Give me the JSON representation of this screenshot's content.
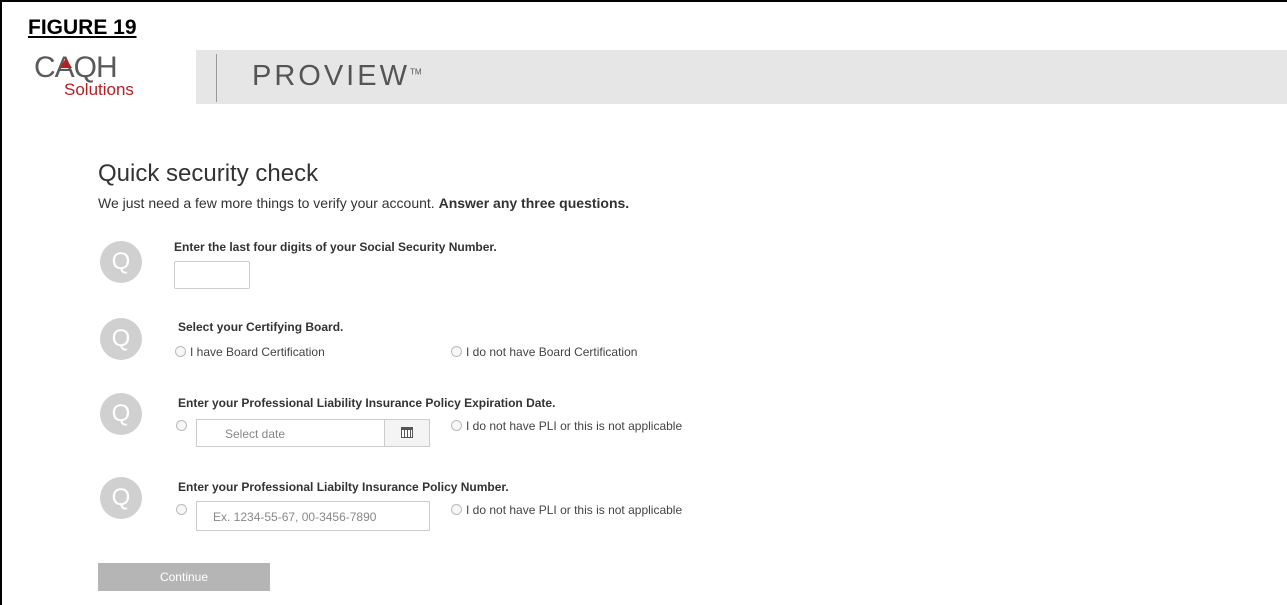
{
  "figure_label": "FIGURE 19",
  "header": {
    "logo_caqh": "CAQH",
    "logo_solutions": "Solutions",
    "product_name": "PROVIEW",
    "trademark": "TM"
  },
  "page": {
    "title": "Quick security check",
    "subtitle": "We just need a few more things to verify your account.",
    "subtitle_bold": "Answer any three questions."
  },
  "questions": [
    {
      "icon": "Q",
      "text": "Enter the last four digits of your Social Security Number.",
      "input_value": ""
    },
    {
      "icon": "Q",
      "text": "Select your Certifying Board.",
      "option_1": "I have Board Certification",
      "option_2": "I do not have Board Certification"
    },
    {
      "icon": "Q",
      "text": "Enter your Professional Liability Insurance Policy Expiration Date.",
      "placeholder": "Select date",
      "option_2": "I do not have PLI or this is not applicable"
    },
    {
      "icon": "Q",
      "text": "Enter your Professional Liabilty Insurance Policy Number.",
      "placeholder": "Ex. 1234-55-67, 00-3456-7890",
      "option_2": "I do not have PLI or this is not applicable"
    }
  ],
  "continue_label": "Continue"
}
